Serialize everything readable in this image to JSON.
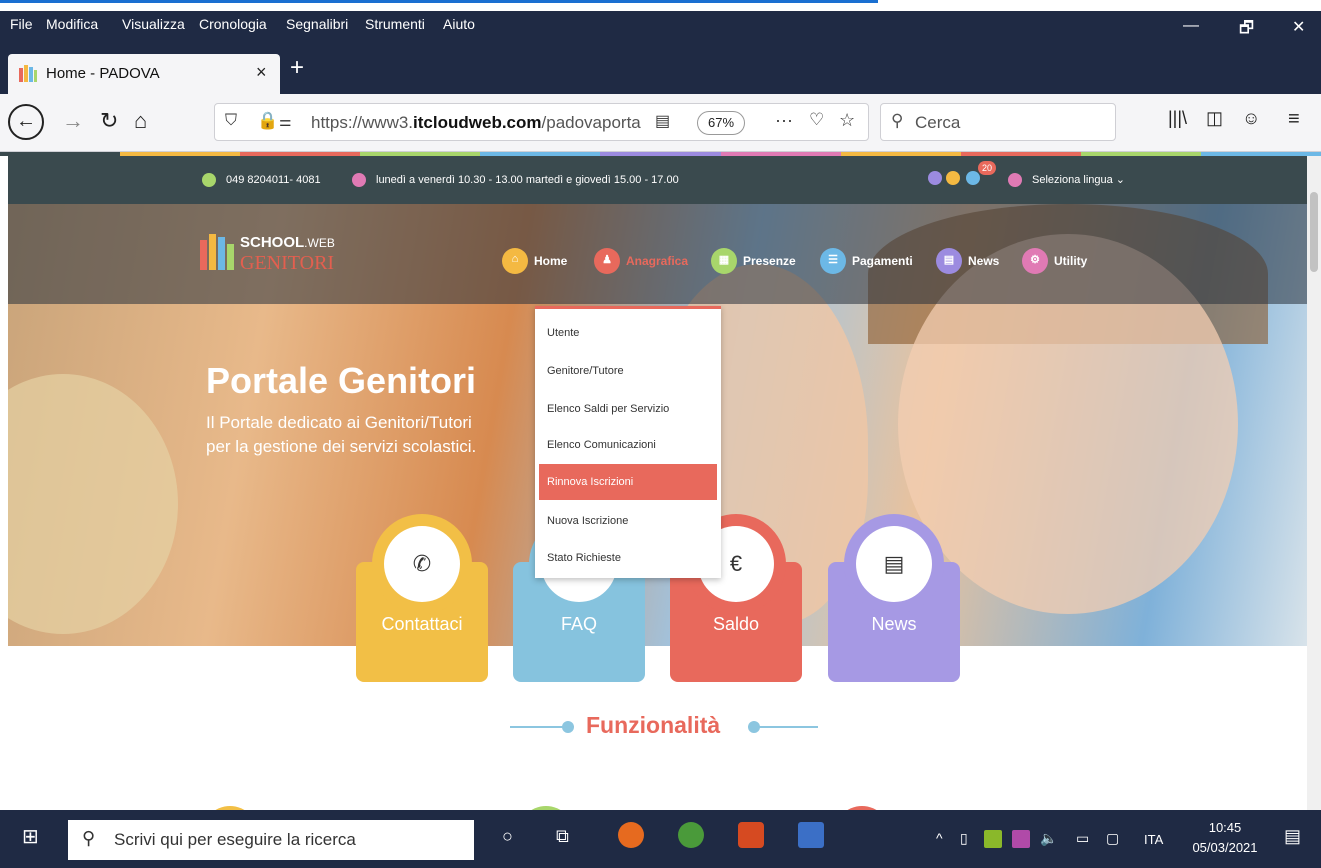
{
  "browser": {
    "menu": [
      "File",
      "Modifica",
      "Visualizza",
      "Cronologia",
      "Segnalibri",
      "Strumenti",
      "Aiuto"
    ],
    "tab_title": "Home - PADOVA",
    "tab_close": "×",
    "new_tab": "+",
    "url_prefix": "https://www3.",
    "url_domain": "itcloudweb.com",
    "url_rest": "/padovaportaleg",
    "zoom": "67%",
    "search_placeholder": "Cerca",
    "window_controls": [
      "—",
      "🗗",
      "✕"
    ]
  },
  "site": {
    "phone": "049 8204011- 4081",
    "hours": "lunedì a venerdì 10.30 - 13.00 martedì e giovedì 15.00 - 17.00",
    "notif_count": "20",
    "language": "Seleziona lingua ⌄",
    "logo_top": "SCHOOL",
    "logo_top_small": ".WEB",
    "logo_bottom": "GENITORI",
    "nav": [
      {
        "label": "Home",
        "color": "#f4b942",
        "icon": "⌂"
      },
      {
        "label": "Anagrafica",
        "color": "#e8695c",
        "icon": "♟"
      },
      {
        "label": "Presenze",
        "color": "#a8d66b",
        "icon": "▦"
      },
      {
        "label": "Pagamenti",
        "color": "#6cb8e6",
        "icon": "☰"
      },
      {
        "label": "News",
        "color": "#9c8be0",
        "icon": "▤"
      },
      {
        "label": "Utility",
        "color": "#e07ab4",
        "icon": "⚙"
      }
    ],
    "hero_title": "Portale Genitori",
    "hero_sub_1": "Il Portale dedicato ai Genitori/Tutori",
    "hero_sub_2": "per la gestione dei servizi scolastici.",
    "dropdown": [
      "Utente",
      "Genitore/Tutore",
      "Elenco Saldi per Servizio",
      "Elenco Comunicazioni",
      "Rinnova Iscrizioni",
      "Nuova Iscrizione",
      "Stato Richieste"
    ],
    "cards": [
      {
        "label": "Contattaci",
        "color": "#f2bf46",
        "icon": "✆"
      },
      {
        "label": "FAQ",
        "color": "#86c3de",
        "icon": "?"
      },
      {
        "label": "Saldo",
        "color": "#e8695c",
        "icon": "€"
      },
      {
        "label": "News",
        "color": "#a699e4",
        "icon": "▤"
      }
    ],
    "section_title": "Funzionalità"
  },
  "taskbar": {
    "search_placeholder": "Scrivi qui per eseguire la ricerca",
    "lang": "ITA",
    "time": "10:45",
    "date": "05/03/2021"
  }
}
